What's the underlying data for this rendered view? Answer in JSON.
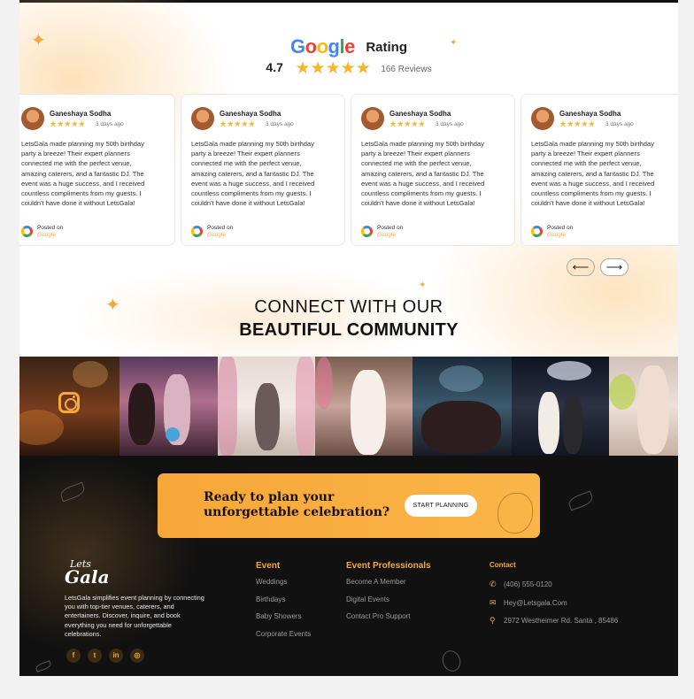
{
  "rating": {
    "logo_letters": [
      "G",
      "o",
      "o",
      "g",
      "l",
      "e"
    ],
    "title": "Rating",
    "score": "4.7",
    "stars": "★★★★★",
    "reviews": "166 Reviews"
  },
  "reviews": [
    {
      "name": "Ganeshaya Sodha",
      "stars": "★★★★★",
      "date": "3 days ago",
      "text": "LetsGala made planning my 50th birthday party a breeze! Their expert planners connected me with the perfect venue, amazing caterers, and a fantastic DJ. The event was a huge success, and I received countless compliments from my guests. I couldn't have done it without LetsGala!",
      "posted_on": "Posted on",
      "source": "Google"
    },
    {
      "name": "Ganeshaya Sodha",
      "stars": "★★★★★",
      "date": "3 days ago",
      "text": "LetsGala made planning my 50th birthday party a breeze! Their expert planners connected me with the perfect venue, amazing caterers, and a fantastic DJ. The event was a huge success, and I received countless compliments from my guests. I couldn't have done it without LetsGala!",
      "posted_on": "Posted on",
      "source": "Google"
    },
    {
      "name": "Ganeshaya Sodha",
      "stars": "★★★★★",
      "date": "3 days ago",
      "text": "LetsGala made planning my 50th birthday party a breeze! Their expert planners connected me with the perfect venue, amazing caterers, and a fantastic DJ. The event was a huge success, and I received countless compliments from my guests. I couldn't have done it without LetsGala!",
      "posted_on": "Posted on",
      "source": "Google"
    },
    {
      "name": "Ganeshaya Sodha",
      "stars": "★★★★★",
      "date": "3 days ago",
      "text": "LetsGala made planning my 50th birthday party a breeze! Their expert planners connected me with the perfect venue, amazing caterers, and a fantastic DJ. The event was a huge success, and I received countless compliments from my guests. I couldn't have done it without LetsGala!",
      "posted_on": "Posted on",
      "source": "Google"
    }
  ],
  "carousel": {
    "prev": "⟵",
    "next": "⟶"
  },
  "community": {
    "line1": "CONNECT WITH OUR",
    "line2": "BEAUTIFUL COMMUNITY"
  },
  "cta": {
    "line1": "Ready to plan your",
    "line2": "unforgettable celebration?",
    "button": "START PLANNING"
  },
  "footer": {
    "brand_top": "Lets",
    "brand_bottom": "Gala",
    "about": "LetsGala simplifies event planning by connecting you with top-tier venues, caterers, and entertainers. Discover, inquire, and book everything you need for unforgettable celebrations.",
    "social": [
      "f",
      "t",
      "in",
      "◎"
    ],
    "event_heading": "Event",
    "event_items": [
      "Weddings",
      "Birthdays",
      "Baby Showers",
      "Corporate Events"
    ],
    "pro_heading": "Event Professionals",
    "pro_items": [
      "Become A Member",
      "Digital Events",
      "Contact Pro Support"
    ],
    "contact_heading": "Contact",
    "phone": "(406) 555-0120",
    "email": "Hey@Letsgala.Com",
    "address": "2972 Westheimer Rd. Santa , 85486"
  },
  "colors": {
    "accent": "#f4a93a",
    "footer_bg": "#111111",
    "star": "#f7b52c"
  }
}
